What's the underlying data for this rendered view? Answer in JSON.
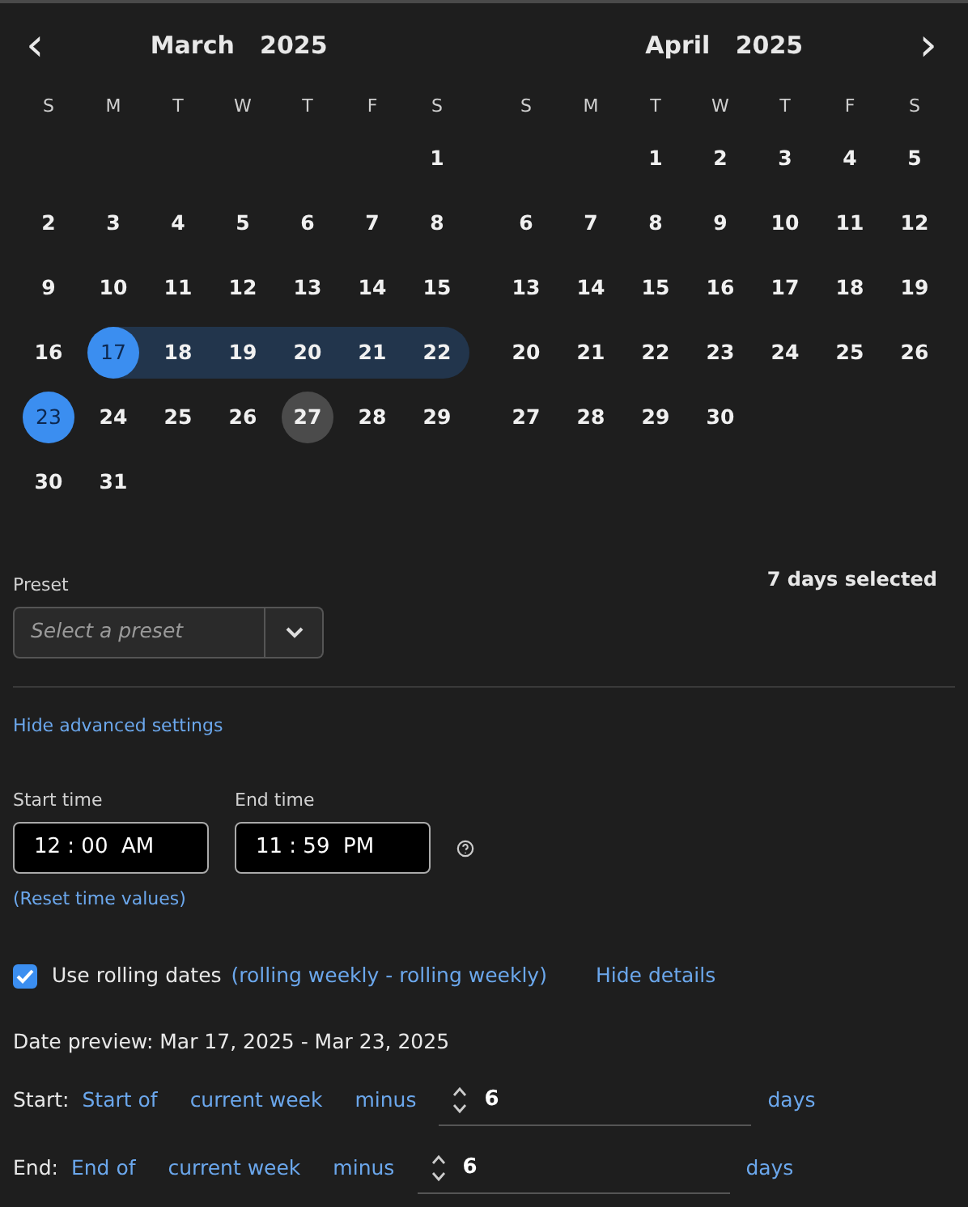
{
  "nav": {
    "prev": "‹",
    "next": "›"
  },
  "months": [
    {
      "title": "March",
      "year": "2025",
      "weekdays": [
        "S",
        "M",
        "T",
        "W",
        "T",
        "F",
        "S"
      ],
      "weeks": [
        [
          {
            "day": "1",
            "selected": false,
            "in_range": false,
            "today": false
          }
        ],
        [
          {
            "day": "2",
            "selected": false,
            "in_range": false,
            "today": false
          },
          {
            "day": "3",
            "selected": false,
            "in_range": false,
            "today": false
          },
          {
            "day": "4",
            "selected": false,
            "in_range": false,
            "today": false
          },
          {
            "day": "5",
            "selected": false,
            "in_range": false,
            "today": false
          },
          {
            "day": "6",
            "selected": false,
            "in_range": false,
            "today": false
          },
          {
            "day": "7",
            "selected": false,
            "in_range": false,
            "today": false
          },
          {
            "day": "8",
            "selected": false,
            "in_range": false,
            "today": false
          }
        ],
        [
          {
            "day": "9",
            "selected": false,
            "in_range": false,
            "today": false
          },
          {
            "day": "10",
            "selected": false,
            "in_range": false,
            "today": false
          },
          {
            "day": "11",
            "selected": false,
            "in_range": false,
            "today": false
          },
          {
            "day": "12",
            "selected": false,
            "in_range": false,
            "today": false
          },
          {
            "day": "13",
            "selected": false,
            "in_range": false,
            "today": false
          },
          {
            "day": "14",
            "selected": false,
            "in_range": false,
            "today": false
          },
          {
            "day": "15",
            "selected": false,
            "in_range": false,
            "today": false
          }
        ],
        [
          {
            "day": "16",
            "selected": false,
            "in_range": false,
            "today": false
          },
          {
            "day": "17",
            "selected": true,
            "in_range": false,
            "today": false
          },
          {
            "day": "18",
            "selected": false,
            "in_range": true,
            "today": false
          },
          {
            "day": "19",
            "selected": false,
            "in_range": true,
            "today": false
          },
          {
            "day": "20",
            "selected": false,
            "in_range": true,
            "today": false
          },
          {
            "day": "21",
            "selected": false,
            "in_range": true,
            "today": false
          },
          {
            "day": "22",
            "selected": false,
            "in_range": true,
            "today": false
          }
        ],
        [
          {
            "day": "23",
            "selected": true,
            "in_range": false,
            "today": false
          },
          {
            "day": "24",
            "selected": false,
            "in_range": false,
            "today": false
          },
          {
            "day": "25",
            "selected": false,
            "in_range": false,
            "today": false
          },
          {
            "day": "26",
            "selected": false,
            "in_range": false,
            "today": false
          },
          {
            "day": "27",
            "selected": false,
            "in_range": false,
            "today": true
          },
          {
            "day": "28",
            "selected": false,
            "in_range": false,
            "today": false
          },
          {
            "day": "29",
            "selected": false,
            "in_range": false,
            "today": false
          }
        ],
        [
          {
            "day": "30",
            "selected": false,
            "in_range": false,
            "today": false
          },
          {
            "day": "31",
            "selected": false,
            "in_range": false,
            "today": false
          }
        ]
      ]
    },
    {
      "title": "April",
      "year": "2025",
      "weekdays": [
        "S",
        "M",
        "T",
        "W",
        "T",
        "F",
        "S"
      ],
      "weeks": [
        [
          {
            "day": "1",
            "selected": false,
            "in_range": false,
            "today": false
          },
          {
            "day": "2",
            "selected": false,
            "in_range": false,
            "today": false
          },
          {
            "day": "3",
            "selected": false,
            "in_range": false,
            "today": false
          },
          {
            "day": "4",
            "selected": false,
            "in_range": false,
            "today": false
          },
          {
            "day": "5",
            "selected": false,
            "in_range": false,
            "today": false
          }
        ],
        [
          {
            "day": "6",
            "selected": false,
            "in_range": false,
            "today": false
          },
          {
            "day": "7",
            "selected": false,
            "in_range": false,
            "today": false
          },
          {
            "day": "8",
            "selected": false,
            "in_range": false,
            "today": false
          },
          {
            "day": "9",
            "selected": false,
            "in_range": false,
            "today": false
          },
          {
            "day": "10",
            "selected": false,
            "in_range": false,
            "today": false
          },
          {
            "day": "11",
            "selected": false,
            "in_range": false,
            "today": false
          },
          {
            "day": "12",
            "selected": false,
            "in_range": false,
            "today": false
          }
        ],
        [
          {
            "day": "13",
            "selected": false,
            "in_range": false,
            "today": false
          },
          {
            "day": "14",
            "selected": false,
            "in_range": false,
            "today": false
          },
          {
            "day": "15",
            "selected": false,
            "in_range": false,
            "today": false
          },
          {
            "day": "16",
            "selected": false,
            "in_range": false,
            "today": false
          },
          {
            "day": "17",
            "selected": false,
            "in_range": false,
            "today": false
          },
          {
            "day": "18",
            "selected": false,
            "in_range": false,
            "today": false
          },
          {
            "day": "19",
            "selected": false,
            "in_range": false,
            "today": false
          }
        ],
        [
          {
            "day": "20",
            "selected": false,
            "in_range": false,
            "today": false
          },
          {
            "day": "21",
            "selected": false,
            "in_range": false,
            "today": false
          },
          {
            "day": "22",
            "selected": false,
            "in_range": false,
            "today": false
          },
          {
            "day": "23",
            "selected": false,
            "in_range": false,
            "today": false
          },
          {
            "day": "24",
            "selected": false,
            "in_range": false,
            "today": false
          },
          {
            "day": "25",
            "selected": false,
            "in_range": false,
            "today": false
          },
          {
            "day": "26",
            "selected": false,
            "in_range": false,
            "today": false
          }
        ],
        [
          {
            "day": "27",
            "selected": false,
            "in_range": false,
            "today": false
          },
          {
            "day": "28",
            "selected": false,
            "in_range": false,
            "today": false
          },
          {
            "day": "29",
            "selected": false,
            "in_range": false,
            "today": false
          },
          {
            "day": "30",
            "selected": false,
            "in_range": false,
            "today": false
          }
        ]
      ]
    }
  ],
  "preset": {
    "label": "Preset",
    "placeholder": "Select a preset",
    "summary": "7 days selected"
  },
  "advanced_link": "Hide advanced settings",
  "times": [
    {
      "label": "Start time",
      "value": "12 : 00  AM"
    },
    {
      "label": "End time",
      "value": "11 : 59  PM"
    }
  ],
  "reset_link": "(Reset time values)",
  "rolling": {
    "checked": true,
    "label": "Use rolling dates",
    "detail": "(rolling weekly - rolling weekly)",
    "toggle": "Hide details"
  },
  "preview": "Date preview: Mar 17, 2025 - Mar 23, 2025",
  "rules": [
    {
      "label": "Start:",
      "anchor": "Start of",
      "period": "current week",
      "operator": "minus",
      "value": "6",
      "unit": "days"
    },
    {
      "label": "End:",
      "anchor": "End of",
      "period": "current week",
      "operator": "minus",
      "value": "6",
      "unit": "days"
    }
  ]
}
